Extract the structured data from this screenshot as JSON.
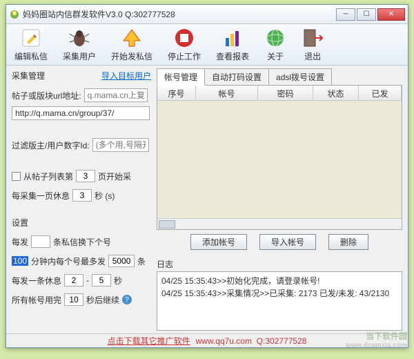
{
  "window": {
    "title": "妈妈圈站内信群发软件V3.0  Q:302777528"
  },
  "toolbar": [
    {
      "label": "编辑私信",
      "icon": "pencil-icon"
    },
    {
      "label": "采集用户",
      "icon": "bug-icon"
    },
    {
      "label": "开始发私信",
      "icon": "send-icon"
    },
    {
      "label": "停止工作",
      "icon": "stop-icon"
    },
    {
      "label": "查看报表",
      "icon": "chart-icon"
    },
    {
      "label": "关于",
      "icon": "globe-icon"
    },
    {
      "label": "退出",
      "icon": "exit-icon"
    }
  ],
  "left": {
    "collect_title": "采集管理",
    "import_link": "导入目标用户",
    "url_label": "帖子或版块url地址:",
    "url_placeholder": "q.mama.cn上复看）",
    "url_value": "http://q.mama.cn/group/37/",
    "filter_label": "过滤版主/用户数字Id:",
    "filter_placeholder": "(多个用,号隔开)",
    "from_page_prefix": "从帖子列表第",
    "from_page_value": "3",
    "from_page_suffix": "页开始采",
    "collect_rest_prefix": "每采集一页休息",
    "collect_rest_value": "3",
    "collect_rest_suffix": "秒 (s)",
    "settings_title": "设置",
    "per_send_prefix": "每发",
    "per_send_value": "",
    "per_send_suffix": "条私信换下个号",
    "min_prefix_hl": "100",
    "min_prefix": "分钟内每个号最多发",
    "min_value": "5000",
    "min_suffix": "条",
    "rest_prefix": "每发一条休息",
    "rest_from": "2",
    "rest_to": "5",
    "rest_dash": "-",
    "rest_suffix": "秒",
    "allacct_prefix": "所有帐号用完",
    "allacct_value": "10",
    "allacct_suffix": "秒后继续"
  },
  "tabs": {
    "account": "帐号管理",
    "autocode": "自动打码设置",
    "adsl": "adsl拨号设置"
  },
  "table": {
    "cols": [
      "序号",
      "帐号",
      "密码",
      "状态",
      "已发"
    ]
  },
  "buttons": {
    "add": "添加帐号",
    "import": "导入帐号",
    "delete": "删除"
  },
  "log": {
    "label": "日志",
    "lines": [
      "04/25 15:35:43>>初始化完成，请登录帐号!",
      "04/25 15:35:43>>采集情况>>已采集: 2173 已发/未发:  43/2130"
    ]
  },
  "footer": {
    "link": "点击下载其它推广软件",
    "site": "www.qq7u.com",
    "qq": "Q:302777528"
  },
  "watermark": {
    "main": "当下软件园",
    "sub": "www.downxia.com"
  }
}
